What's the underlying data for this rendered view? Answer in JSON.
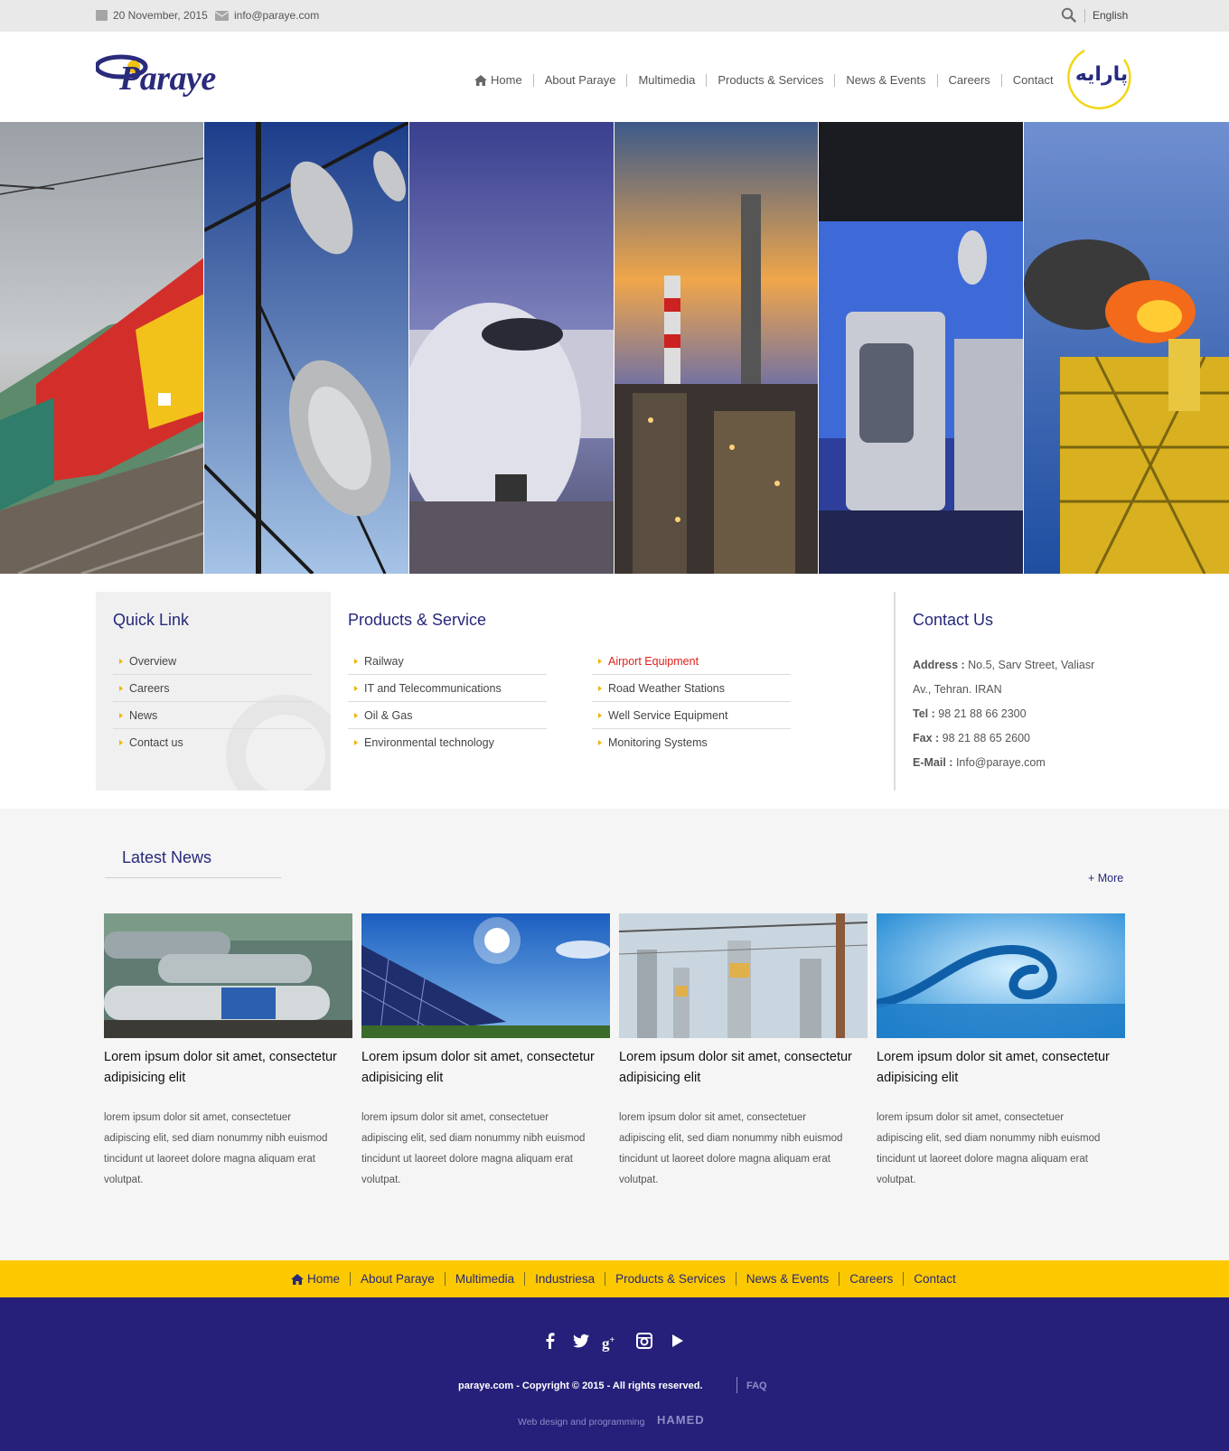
{
  "topbar": {
    "date": "20 November, 2015",
    "email": "info@paraye.com",
    "language": "English"
  },
  "header": {
    "logo_text": "Paraye",
    "logo_fa": "پارایه",
    "nav": [
      "Home",
      "About Paraye",
      "Multimedia",
      "Products & Services",
      "News & Events",
      "Careers",
      "Contact"
    ]
  },
  "quick_links": {
    "title": "Quick Link",
    "items": [
      "Overview",
      "Careers",
      "News",
      "Contact us"
    ]
  },
  "products": {
    "title": "Products & Service",
    "col1": [
      "Railway",
      "IT and Telecommunications",
      "Oil & Gas",
      "Environmental technology"
    ],
    "col2": [
      "Airport Equipment",
      "Road Weather Stations",
      "Well Service Equipment",
      "Monitoring Systems"
    ]
  },
  "contact": {
    "title": "Contact Us",
    "address_label": "Address :",
    "address_1": "No.5, Sarv Street, Valiasr",
    "address_2": "Av., Tehran. IRAN",
    "tel_label": "Tel :",
    "tel": "98 21 88 66 2300",
    "fax_label": "Fax :",
    "fax": "98 21 88 65 2600",
    "email_label": "E-Mail :",
    "email": "Info@paraye.com"
  },
  "news": {
    "title": "Latest News",
    "more": "+ More",
    "items": [
      {
        "title": "Lorem ipsum dolor sit amet, consectetur adipisicing elit",
        "text": "lorem ipsum dolor sit amet, consectetuer adipiscing elit, sed diam nonummy nibh euismod tincidunt ut laoreet dolore magna aliquam erat volutpat."
      },
      {
        "title": "Lorem ipsum dolor sit amet, consectetur adipisicing elit",
        "text": "lorem ipsum dolor sit amet, consectetuer adipiscing elit, sed diam nonummy nibh euismod tincidunt ut laoreet dolore magna aliquam erat volutpat."
      },
      {
        "title": "Lorem ipsum dolor sit amet, consectetur adipisicing elit",
        "text": "lorem ipsum dolor sit amet, consectetuer adipiscing elit, sed diam nonummy nibh euismod tincidunt ut laoreet dolore magna aliquam erat volutpat."
      },
      {
        "title": "Lorem ipsum dolor sit amet, consectetur adipisicing elit",
        "text": "lorem ipsum dolor sit amet, consectetuer adipiscing elit, sed diam nonummy nibh euismod tincidunt ut laoreet dolore magna aliquam erat volutpat."
      }
    ]
  },
  "footer_nav": [
    "Home",
    "About Paraye",
    "Multimedia",
    "Industriesa",
    "Products & Services",
    "News & Events",
    "Careers",
    "Contact"
  ],
  "footer": {
    "social": [
      "facebook-icon",
      "twitter-icon",
      "google-plus-icon",
      "instagram-icon",
      "youtube-icon"
    ],
    "copyright": "paraye.com - Copyright © 2015 - All rights reserved.",
    "faq": "FAQ",
    "credit": "Web design and programming",
    "credit_brand": "HAMED"
  },
  "colors": {
    "brand_navy": "#26207a",
    "accent_yellow": "#fcc800",
    "active_red": "#e0201c",
    "topbar_grey": "#e9e9e9"
  }
}
